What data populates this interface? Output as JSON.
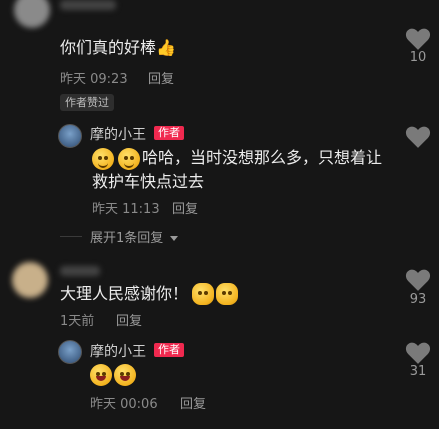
{
  "comments": [
    {
      "text": "你们真的好棒👍",
      "time": "昨天 09:23",
      "reply_label": "回复",
      "badge": "作者赞过",
      "likes": "10",
      "replies": [
        {
          "author": "摩的小王",
          "author_tag": "作者",
          "text_line1": "哈哈，当时没想那么多，只想着让",
          "text_line2": "救护车快点过去",
          "time": "昨天 11:13",
          "reply_label": "回复"
        }
      ],
      "expand_label": "展开1条回复"
    },
    {
      "text": "大理人民感谢你！",
      "time": "1天前",
      "reply_label": "回复",
      "likes": "93",
      "replies": [
        {
          "author": "摩的小王",
          "author_tag": "作者",
          "time": "昨天 00:06",
          "reply_label": "回复",
          "likes": "31"
        }
      ]
    }
  ],
  "colors": {
    "background": "#161616",
    "author_tag": "#f0294f",
    "heart": "#7a7a7a"
  },
  "icons": [
    "heart-icon",
    "thumbs-up-emoji",
    "grin-emoji",
    "laugh-emoji",
    "clap-emoji",
    "chevron-down-icon"
  ]
}
